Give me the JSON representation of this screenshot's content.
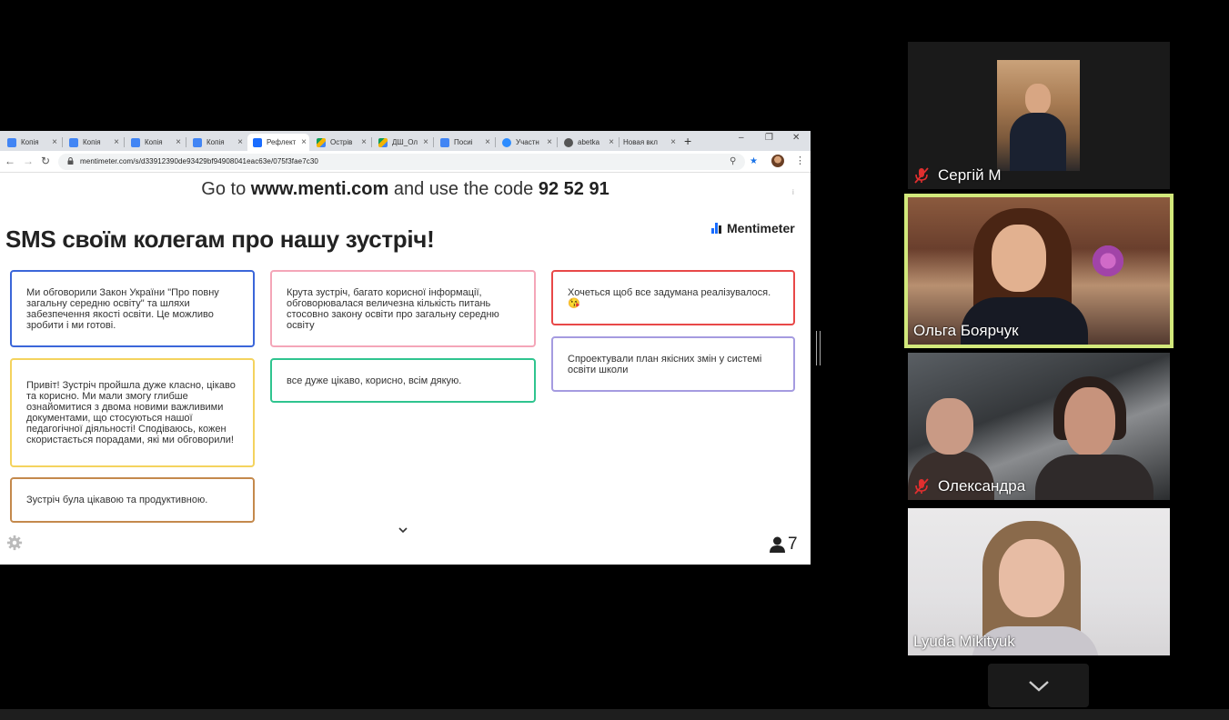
{
  "browser": {
    "tabs": [
      {
        "title": "Копія",
        "favicon_color": "#4285f4",
        "active": false
      },
      {
        "title": "Копія",
        "favicon_color": "#4285f4",
        "active": false
      },
      {
        "title": "Копія",
        "favicon_color": "#4285f4",
        "active": false
      },
      {
        "title": "Копія",
        "favicon_color": "#4285f4",
        "active": false
      },
      {
        "title": "Рефлект",
        "favicon_color": "#196cff",
        "active": true
      },
      {
        "title": "Острів",
        "favicon_color": "#0f9d58",
        "active": false
      },
      {
        "title": "ДШ_Ол",
        "favicon_color": "#f4b400",
        "active": false
      },
      {
        "title": "Посиі",
        "favicon_color": "#4285f4",
        "active": false
      },
      {
        "title": "Участн",
        "favicon_color": "#2d8cff",
        "active": false
      },
      {
        "title": "abetka",
        "favicon_color": "#555555",
        "active": false
      },
      {
        "title": "Новая вкл",
        "favicon_color": "",
        "active": false
      }
    ],
    "new_tab_glyph": "+",
    "window_controls": [
      "–",
      "❐",
      "✕"
    ],
    "nav": {
      "back": "←",
      "forward": "→",
      "reload": "↻"
    },
    "url": "mentimeter.com/s/d33912390de93429bf94908041eac63e/075f3fae7c30",
    "omni_icons": {
      "search": "⚲",
      "bookmark": "★"
    },
    "menu_glyph": "⋮"
  },
  "menti": {
    "join_prefix": "Go to ",
    "join_site": "www.menti.com",
    "join_middle": " and use the code ",
    "join_code": "92 52 91",
    "info_glyph": "i",
    "title": "SMS своїм колегам про нашу зустріч!",
    "logo_text": "Mentimeter",
    "accent": "#196cff",
    "participants": "7",
    "cards": [
      {
        "text": "Ми обговорили Закон України \"Про повну загальну середню освіту\" та шляхи забезпечення якості освіти. Це можливо зробити і ми готові.",
        "color": "#3b66d9"
      },
      {
        "text": "Привіт! Зустріч пройшла дуже класно, цікаво та корисно. Ми мали змогу глибше ознайомитися з двома новими важливими документами, що стосуються нашої педагогічної діяльності! Сподіваюсь, кожен скористається порадами, які ми обговорили!",
        "color": "#f4d35e"
      },
      {
        "text": "Зустріч була цікавою та продуктивною.",
        "color": "#c4894c"
      },
      {
        "text": "Крута зустріч, багато корисної інформації, обговорювалася величезна кількість питань стосовно закону освіти про загальну середню освіту",
        "color": "#f4a6b8"
      },
      {
        "text": "все дуже цікаво, корисно, всім дякую.",
        "color": "#2fc48f"
      },
      {
        "text": "Хочеться щоб все задумана реалізувалося. 😘",
        "color": "#e84848"
      },
      {
        "text": "Спроектували план якісних змін у системі освіти школи",
        "color": "#a59be0"
      }
    ]
  },
  "participants": [
    {
      "name": "Сергій М",
      "muted": true
    },
    {
      "name": "Ольга Боярчук",
      "muted": false,
      "speaking": true
    },
    {
      "name": "Олександра",
      "muted": true
    },
    {
      "name": "Lyuda Mikityuk",
      "muted": false
    }
  ],
  "colors": {
    "speaking_outline": "#d2e87b",
    "mic_muted": "#e02f2f"
  }
}
